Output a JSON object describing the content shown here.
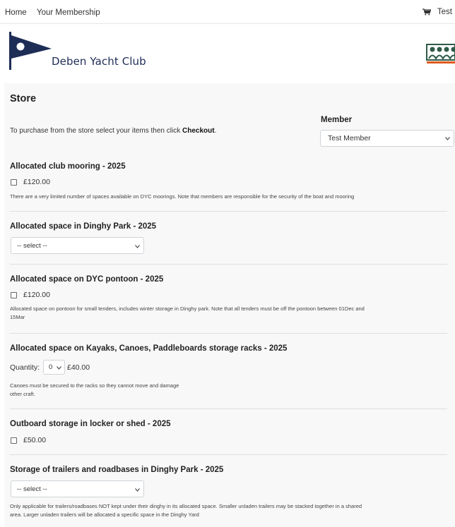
{
  "nav": {
    "home": "Home",
    "membership": "Your Membership",
    "cart_label": "Test",
    "cart_icon": "cart-icon"
  },
  "brand": {
    "club_name": "Deben Yacht Club",
    "burgee_color": "#1e2d56",
    "accent_color": "#e05a1e"
  },
  "store": {
    "title": "Store",
    "intro_text": "To purchase from the store select your items then click ",
    "intro_bold": "Checkout",
    "intro_end": ".",
    "member_label": "Member",
    "member_value": "Test Member"
  },
  "items": [
    {
      "title": "Allocated club mooring - 2025",
      "price": "£120.00",
      "note": "There are a very limited number of spaces available on DYC moorings. Note that members are responsible for the security of the boat and mooring"
    },
    {
      "title": "Allocated space in Dinghy Park - 2025",
      "select_value": "-- select --"
    },
    {
      "title": "Allocated space on DYC pontoon - 2025",
      "price": "£120.00",
      "note_line1": "Allocated space on pontoon for small tenders, includes winter storage in Dinghy park. Note that all tenders must be off the pontoon between 01Dec and",
      "note_line2": "15Mar"
    },
    {
      "title": "Allocated space on Kayaks, Canoes, Paddleboards storage racks - 2025",
      "qty_label": "Quantity:",
      "qty_value": "0",
      "price": "£40.00",
      "note_line1": "Canoes must be secured to the racks so they cannot move and damage",
      "note_line2": "other craft."
    },
    {
      "title": "Outboard storage in locker or shed - 2025",
      "price": "£50.00"
    },
    {
      "title": "Storage of trailers and roadbases in Dinghy Park - 2025",
      "select_value": "-- select --",
      "note_line1": "Only applicable for trailers/roadbases NOT kept under their dinghy in its allocated space. Smaller unladen trailers may be stacked together in a shared",
      "note_line2": "area. Larger unladen trailers will be allocated a specific space in the Dinghy Yard"
    }
  ]
}
